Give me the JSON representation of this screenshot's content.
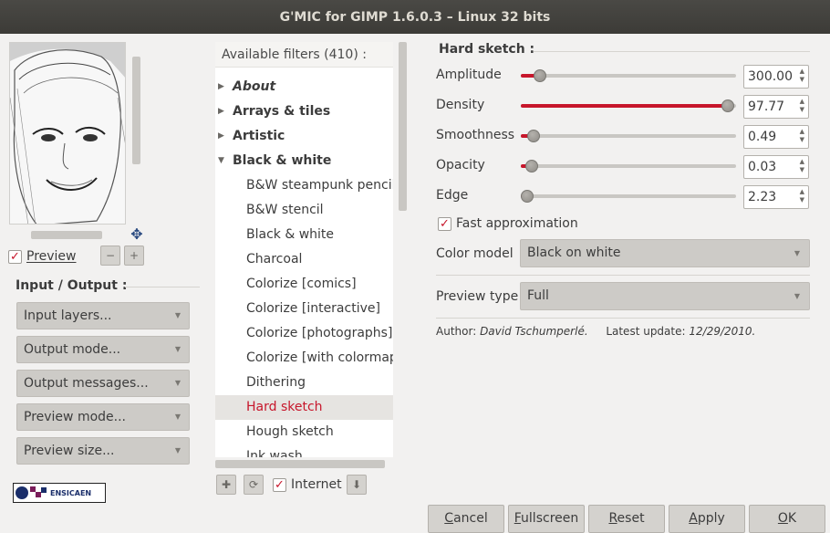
{
  "window": {
    "title": "G'MIC for GIMP 1.6.0.3 – Linux 32 bits"
  },
  "left": {
    "preview_label": "Preview",
    "preview_checked": true,
    "input_output_title": "Input / Output :",
    "dropdowns": [
      "Input layers...",
      "Output mode...",
      "Output messages...",
      "Preview mode...",
      "Preview size..."
    ],
    "logo_text": "ENSICAEN"
  },
  "filters": {
    "header": "Available filters (410) :",
    "items": [
      {
        "label": "About",
        "kind": "category-italic",
        "expanded": false
      },
      {
        "label": "Arrays & tiles",
        "kind": "category",
        "expanded": false
      },
      {
        "label": "Artistic",
        "kind": "category",
        "expanded": false
      },
      {
        "label": "Black & white",
        "kind": "category",
        "expanded": true
      },
      {
        "label": "B&W steampunk pencil",
        "kind": "item"
      },
      {
        "label": "B&W stencil",
        "kind": "item"
      },
      {
        "label": "Black & white",
        "kind": "item"
      },
      {
        "label": "Charcoal",
        "kind": "item"
      },
      {
        "label": "Colorize [comics]",
        "kind": "item"
      },
      {
        "label": "Colorize [interactive]",
        "kind": "item"
      },
      {
        "label": "Colorize [photographs]",
        "kind": "item"
      },
      {
        "label": "Colorize [with colormap]",
        "kind": "item"
      },
      {
        "label": "Dithering",
        "kind": "item"
      },
      {
        "label": "Hard sketch",
        "kind": "item",
        "selected": true
      },
      {
        "label": "Hough sketch",
        "kind": "item"
      },
      {
        "label": "Ink wash",
        "kind": "item"
      }
    ],
    "internet_label": "Internet",
    "internet_checked": true
  },
  "params": {
    "title": "Hard sketch :",
    "sliders": [
      {
        "label": "Amplitude",
        "value": "300.00",
        "fraction": 0.09
      },
      {
        "label": "Density",
        "value": "97.77",
        "fraction": 0.96
      },
      {
        "label": "Smoothness",
        "value": "0.49",
        "fraction": 0.06
      },
      {
        "label": "Opacity",
        "value": "0.03",
        "fraction": 0.05
      },
      {
        "label": "Edge",
        "value": "2.23",
        "fraction": 0.03
      }
    ],
    "fast_approx_label": "Fast approximation",
    "fast_approx_checked": true,
    "color_model_label": "Color model",
    "color_model_value": "Black on white",
    "preview_type_label": "Preview type",
    "preview_type_value": "Full",
    "author_label": "Author:",
    "author_name": "David Tschumperlé.",
    "update_label": "Latest update:",
    "update_date": "12/29/2010."
  },
  "buttons": {
    "cancel": {
      "mnemonic": "C",
      "rest": "ancel"
    },
    "fullscreen": {
      "mnemonic": "F",
      "rest": "ullscreen"
    },
    "reset": {
      "mnemonic": "R",
      "rest": "eset"
    },
    "apply": {
      "mnemonic": "A",
      "rest": "pply"
    },
    "ok": {
      "mnemonic": "O",
      "rest": "K"
    }
  },
  "colors": {
    "accent": "#c7162b",
    "title_bg": "#3c3b37"
  },
  "icons": [
    "move-icon",
    "zoom-out-icon",
    "zoom-in-icon",
    "add-icon",
    "refresh-icon",
    "download-icon",
    "expand-arrow-icon",
    "collapse-arrow-icon",
    "dropdown-arrow-icon",
    "spin-arrows-icon",
    "checkmark-icon"
  ]
}
